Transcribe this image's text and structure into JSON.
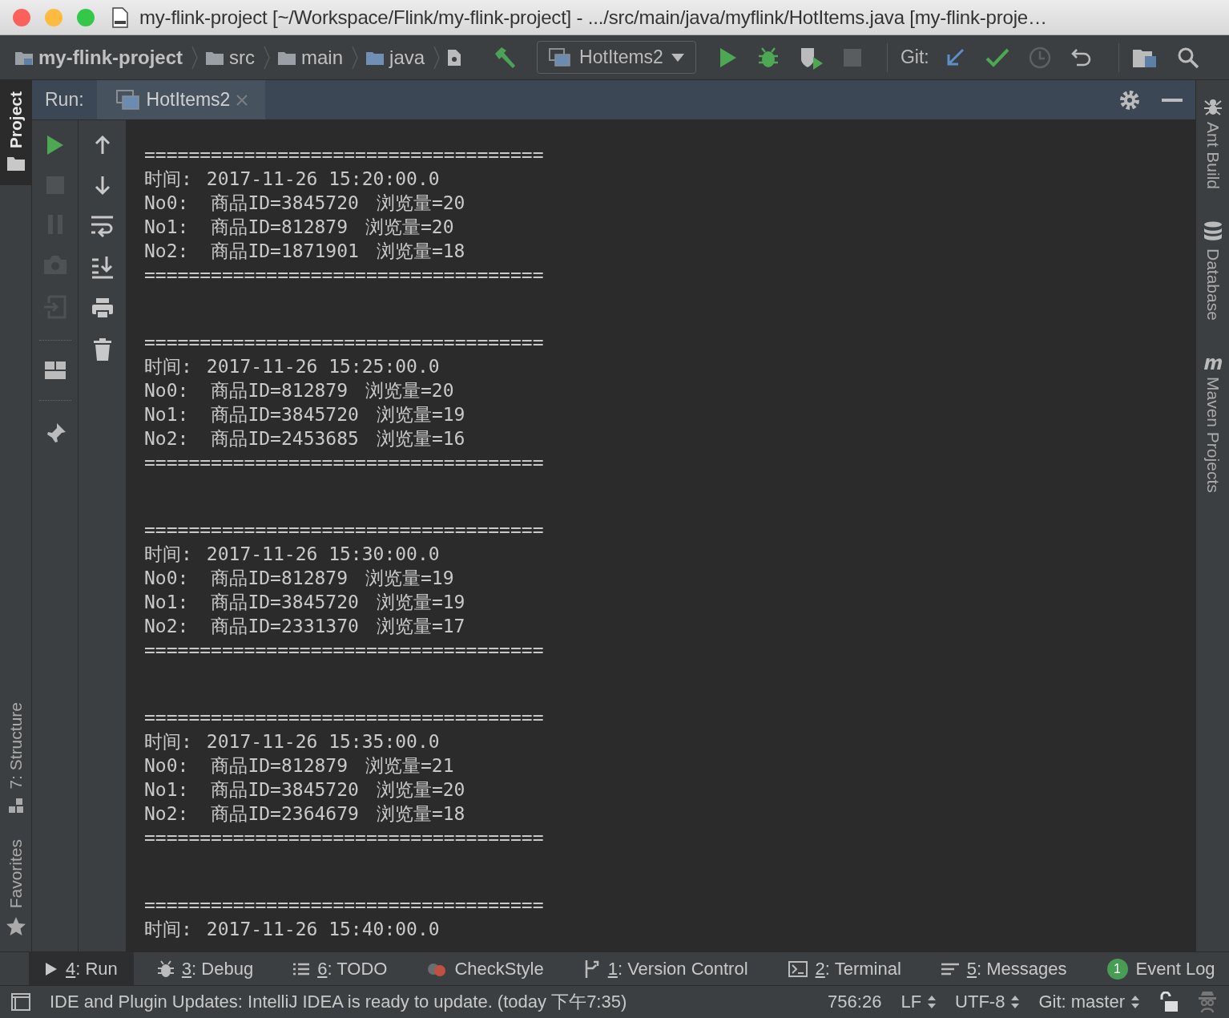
{
  "window": {
    "title": "my-flink-project [~/Workspace/Flink/my-flink-project] - .../src/main/java/myflink/HotItems.java [my-flink-proje…"
  },
  "navbar": {
    "breadcrumbs": [
      {
        "label": "my-flink-project",
        "kind": "project"
      },
      {
        "label": "src",
        "kind": "folder"
      },
      {
        "label": "main",
        "kind": "folder"
      },
      {
        "label": "java",
        "kind": "source"
      }
    ],
    "run_config": "HotItems2",
    "git_label": "Git:"
  },
  "left_stripe": {
    "top": [
      {
        "label": "Project",
        "selected": true
      }
    ],
    "bottom": [
      {
        "label": "7: Structure",
        "selected": false
      },
      {
        "label": "Favorites",
        "selected": false
      }
    ]
  },
  "run_panel": {
    "label": "Run:",
    "tabs": [
      {
        "label": "HotItems2",
        "selected": true
      }
    ],
    "console": {
      "blocks": [
        {
          "rule": "====================================",
          "time_label": "时间:",
          "time": "2017-11-26 15:20:00.0",
          "rows": [
            {
              "rank": "No0:",
              "item": "商品ID=3845720",
              "views": "浏览量=20"
            },
            {
              "rank": "No1:",
              "item": "商品ID=812879",
              "views": "浏览量=20"
            },
            {
              "rank": "No2:",
              "item": "商品ID=1871901",
              "views": "浏览量=18"
            }
          ],
          "end_rule": "===================================="
        },
        {
          "rule": "====================================",
          "time_label": "时间:",
          "time": "2017-11-26 15:25:00.0",
          "rows": [
            {
              "rank": "No0:",
              "item": "商品ID=812879",
              "views": "浏览量=20"
            },
            {
              "rank": "No1:",
              "item": "商品ID=3845720",
              "views": "浏览量=19"
            },
            {
              "rank": "No2:",
              "item": "商品ID=2453685",
              "views": "浏览量=16"
            }
          ],
          "end_rule": "===================================="
        },
        {
          "rule": "====================================",
          "time_label": "时间:",
          "time": "2017-11-26 15:30:00.0",
          "rows": [
            {
              "rank": "No0:",
              "item": "商品ID=812879",
              "views": "浏览量=19"
            },
            {
              "rank": "No1:",
              "item": "商品ID=3845720",
              "views": "浏览量=19"
            },
            {
              "rank": "No2:",
              "item": "商品ID=2331370",
              "views": "浏览量=17"
            }
          ],
          "end_rule": "===================================="
        },
        {
          "rule": "====================================",
          "time_label": "时间:",
          "time": "2017-11-26 15:35:00.0",
          "rows": [
            {
              "rank": "No0:",
              "item": "商品ID=812879",
              "views": "浏览量=21"
            },
            {
              "rank": "No1:",
              "item": "商品ID=3845720",
              "views": "浏览量=20"
            },
            {
              "rank": "No2:",
              "item": "商品ID=2364679",
              "views": "浏览量=18"
            }
          ],
          "end_rule": "===================================="
        },
        {
          "rule": "====================================",
          "time_label": "时间:",
          "time": "2017-11-26 15:40:00.0"
        }
      ]
    }
  },
  "right_stripe": [
    {
      "label": "Ant Build"
    },
    {
      "label": "Database"
    },
    {
      "label": "Maven Projects"
    }
  ],
  "tool_tabs": [
    {
      "key": "4",
      "label": ": Run",
      "selected": true
    },
    {
      "key": "3",
      "label": ": Debug",
      "selected": false
    },
    {
      "key": "6",
      "label": ": TODO",
      "selected": false
    },
    {
      "label": "CheckStyle",
      "selected": false
    },
    {
      "key": "1",
      "label": ": Version Control",
      "selected": false
    },
    {
      "key": "2",
      "label": ": Terminal",
      "selected": false
    },
    {
      "key": "5",
      "label": ": Messages",
      "selected": false
    },
    {
      "badge": "1",
      "label": "Event Log",
      "selected": false
    }
  ],
  "status_bar": {
    "message": "IDE and Plugin Updates: IntelliJ IDEA is ready to update. (today 下午7:35)",
    "position": "756:26",
    "line_separator": "LF",
    "encoding": "UTF-8",
    "vcs": "Git: master"
  }
}
